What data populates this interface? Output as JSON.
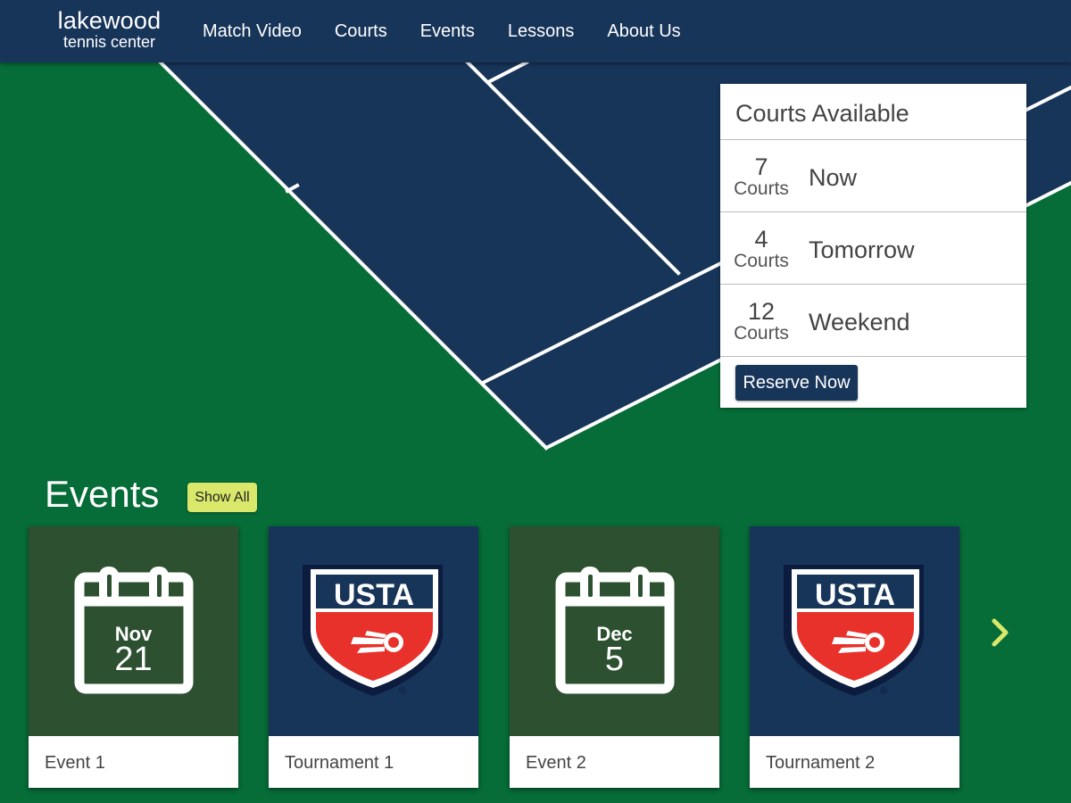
{
  "nav": {
    "logo_main": "lakewood",
    "logo_sub": "tennis center",
    "links": [
      "Match Video",
      "Courts",
      "Events",
      "Lessons",
      "About Us"
    ]
  },
  "availability": {
    "title": "Courts Available",
    "rows": [
      {
        "count": "7",
        "unit": "Courts",
        "when": "Now"
      },
      {
        "count": "4",
        "unit": "Courts",
        "when": "Tomorrow"
      },
      {
        "count": "12",
        "unit": "Courts",
        "when": "Weekend"
      }
    ],
    "reserve_label": "Reserve Now"
  },
  "events": {
    "title": "Events",
    "show_all_label": "Show All",
    "cards": [
      {
        "type": "calendar",
        "month": "Nov",
        "day": "21",
        "label": "Event 1"
      },
      {
        "type": "usta",
        "logo_text": "USTA",
        "label": "Tournament 1"
      },
      {
        "type": "calendar",
        "month": "Dec",
        "day": "5",
        "label": "Event 2"
      },
      {
        "type": "usta",
        "logo_text": "USTA",
        "label": "Tournament 2"
      }
    ],
    "next_icon": "chevron-right-icon"
  },
  "colors": {
    "nav_bg": "#173459",
    "grass": "#066c38",
    "court": "#173459",
    "event_green": "#2c5030",
    "accent_yellow": "#d9e86a",
    "usta_red": "#e8312a"
  }
}
